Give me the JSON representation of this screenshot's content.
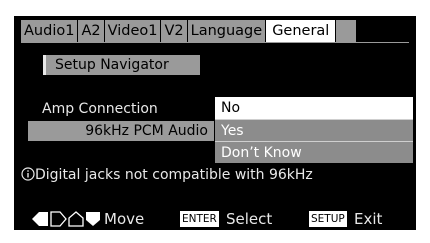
{
  "tabs": [
    {
      "label": "Audio1"
    },
    {
      "label": "A2"
    },
    {
      "label": "Video1"
    },
    {
      "label": "V2"
    },
    {
      "label": "Language"
    },
    {
      "label": "General"
    }
  ],
  "setup_navigator": {
    "label": "Setup Navigator"
  },
  "settings": {
    "amp_connection": "Amp Connection",
    "pcm_audio": "96kHz PCM Audio"
  },
  "dropdown": {
    "options": [
      "No",
      "Yes",
      "Don’t Know"
    ],
    "selected": "No"
  },
  "info": {
    "icon": "info-icon",
    "text": "Digital jacks not compatible with 96kHz"
  },
  "footer": {
    "move": "Move",
    "enter_key": "ENTER",
    "select": "Select",
    "setup_key": "SETUP",
    "exit": "Exit"
  },
  "colors": {
    "screen_bg": "#000000",
    "tab_bg": "#9a9a9a",
    "tab_active_bg": "#ffffff",
    "option_bg": "#8c8c8c",
    "text": "#e8e8e8"
  }
}
